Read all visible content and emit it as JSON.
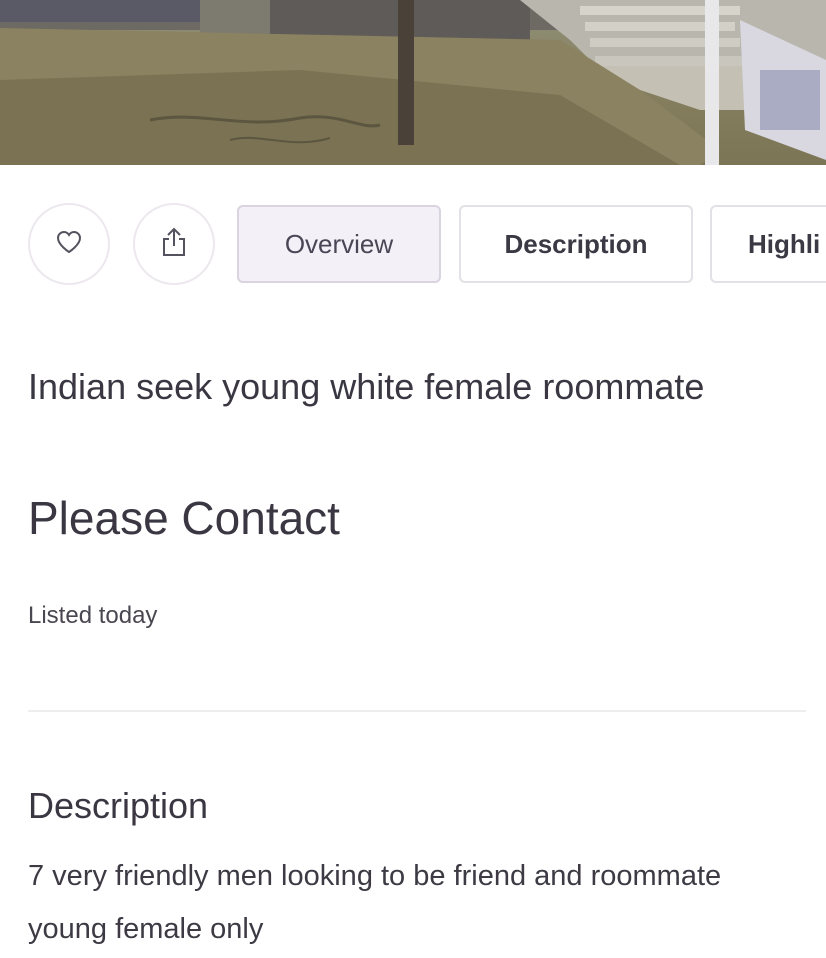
{
  "hero": {
    "photo_icon": "listing-photo"
  },
  "actions": {
    "like_icon": "heart-icon",
    "share_icon": "share-icon",
    "tabs": [
      {
        "label": "Overview",
        "active": true
      },
      {
        "label": "Description",
        "active": false
      },
      {
        "label": "Highli",
        "active": false
      }
    ]
  },
  "listing": {
    "title": "Indian seek young white female roommate",
    "price": "Please Contact",
    "listed": "Listed today"
  },
  "description": {
    "heading": "Description",
    "body": "7 very friendly men looking to be friend and roommate young female only"
  },
  "colors": {
    "text": "#3a3742",
    "active_tab_bg": "#f3f1f7",
    "border": "#e3e0e6"
  }
}
